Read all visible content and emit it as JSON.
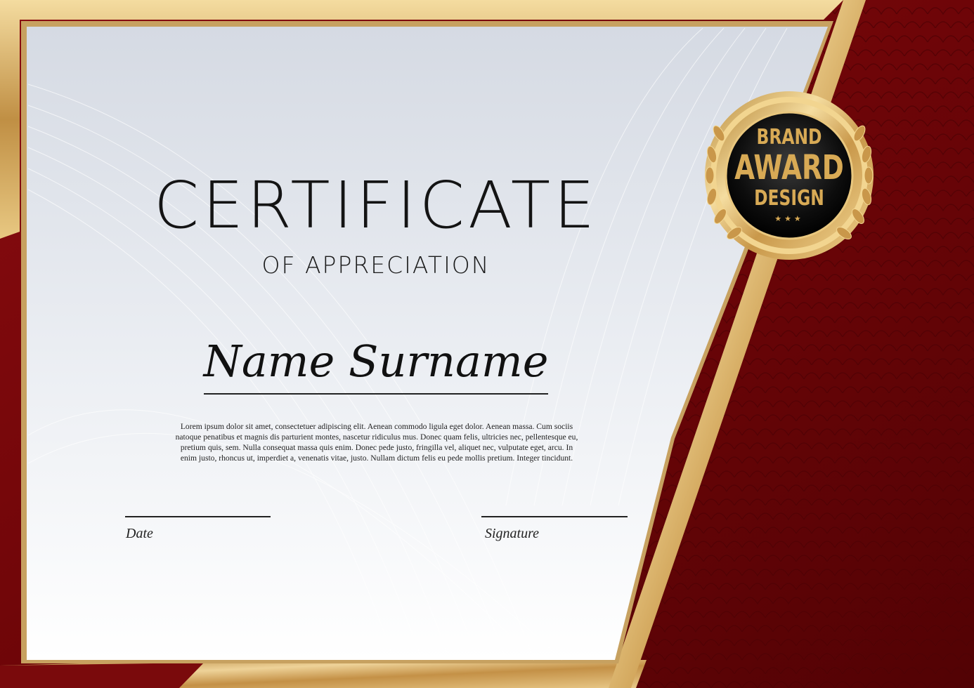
{
  "certificate": {
    "title": "CERTIFICATE",
    "subtitle": "OF APPRECIATION",
    "recipient_name": "Name Surname",
    "body_text": "Lorem ipsum dolor sit amet, consectetuer adipiscing elit. Aenean commodo ligula eget dolor. Aenean massa. Cum sociis natoque penatibus et magnis dis parturient montes, nascetur ridiculus mus. Donec quam felis, ultricies nec, pellentesque eu, pretium quis, sem. Nulla consequat massa quis enim. Donec pede justo, fringilla vel, aliquet nec, vulputate eget, arcu. In enim justo, rhoncus ut, imperdiet a, venenatis vitae, justo. Nullam dictum felis eu pede mollis pretium. Integer tincidunt.",
    "date_label": "Date",
    "signature_label": "Signature"
  },
  "badge": {
    "line1": "BRAND",
    "line2": "AWARD",
    "line3": "DESIGN",
    "stars": "★★★"
  },
  "colors": {
    "red": "#7a0a0c",
    "dark_red": "#5a0406",
    "gold": "#d6ad60",
    "light_gold": "#f3dca0",
    "paper": "#eef1f6",
    "seal_black": "#111111"
  }
}
